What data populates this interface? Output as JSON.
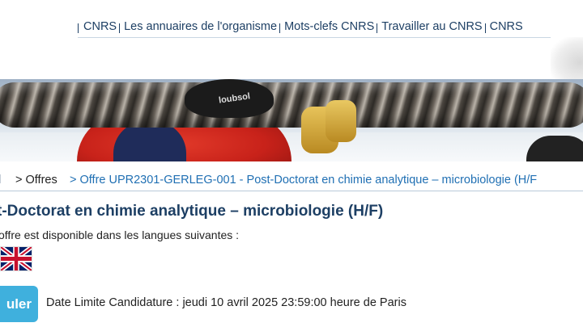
{
  "topnav": {
    "items": [
      {
        "label": "CNRS"
      },
      {
        "label": "Les annuaires de l'organisme"
      },
      {
        "label": "Mots-clefs CNRS"
      },
      {
        "label": "Travailler au CNRS"
      },
      {
        "label": "CNRS"
      }
    ]
  },
  "banner": {
    "helmet_text": "loubsol"
  },
  "breadcrumb": {
    "first": "l",
    "offres": "> Offres",
    "current": "> Offre UPR2301-GERLEG-001 - Post-Doctorat en chimie analytique – microbiologie (H/F"
  },
  "offer": {
    "title": "t-Doctorat en chimie analytique – microbiologie (H/F)",
    "lang_note": "offre est disponible dans les langues suivantes :",
    "flag_icon": "uk-flag-icon",
    "apply_label": "uler",
    "deadline": "Date Limite Candidature : jeudi 10 avril 2025 23:59:00 heure de Paris"
  },
  "colors": {
    "nav_link": "#1d3f64",
    "breadcrumb_link": "#1f6fb3",
    "apply_button": "#3fb0dd"
  }
}
